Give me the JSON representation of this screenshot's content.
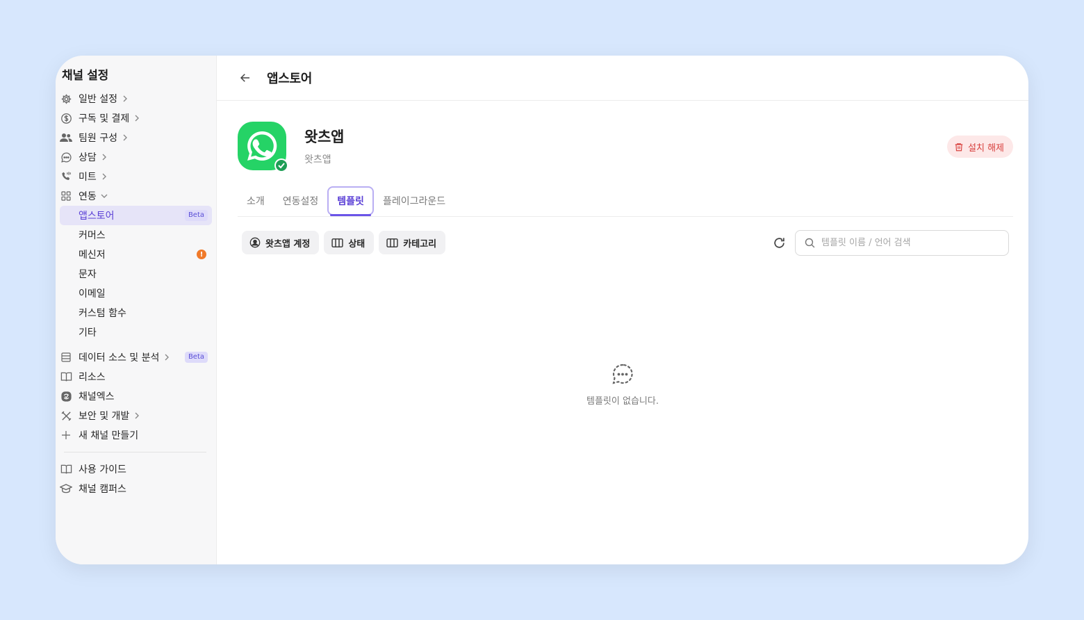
{
  "sidebar": {
    "title": "채널 설정",
    "items": [
      {
        "label": "일반 설정"
      },
      {
        "label": "구독 및 결제"
      },
      {
        "label": "팀원 구성"
      },
      {
        "label": "상담"
      },
      {
        "label": "미트"
      },
      {
        "label": "연동"
      }
    ],
    "integration_sub": [
      {
        "label": "앱스토어",
        "badge": "Beta"
      },
      {
        "label": "커머스"
      },
      {
        "label": "메신저",
        "badge": "!"
      },
      {
        "label": "문자"
      },
      {
        "label": "이메일"
      },
      {
        "label": "커스텀 함수"
      },
      {
        "label": "기타"
      }
    ],
    "items2": [
      {
        "label": "데이터 소스 및 분석",
        "badge": "Beta"
      },
      {
        "label": "리소스"
      },
      {
        "label": "채널엑스"
      },
      {
        "label": "보안 및 개발"
      },
      {
        "label": "새 채널 만들기"
      }
    ],
    "footer": [
      {
        "label": "사용 가이드"
      },
      {
        "label": "채널 캠퍼스"
      }
    ]
  },
  "header": {
    "title": "앱스토어"
  },
  "app": {
    "name": "왓츠앱",
    "subtitle": "왓츠앱",
    "uninstall_label": "설치 해제",
    "brand_color": "#25D366"
  },
  "tabs": [
    {
      "label": "소개"
    },
    {
      "label": "연동설정"
    },
    {
      "label": "템플릿",
      "active": true
    },
    {
      "label": "플레이그라운드"
    }
  ],
  "filters": [
    {
      "label": "왓츠앱 계정"
    },
    {
      "label": "상태"
    },
    {
      "label": "카테고리"
    }
  ],
  "search": {
    "placeholder": "템플릿 이름 / 언어 검색",
    "value": ""
  },
  "empty": {
    "text": "템플릿이 없습니다."
  },
  "colors": {
    "accent": "#5a3fd6",
    "danger": "#d8413e",
    "background": "#d7e7fd"
  }
}
